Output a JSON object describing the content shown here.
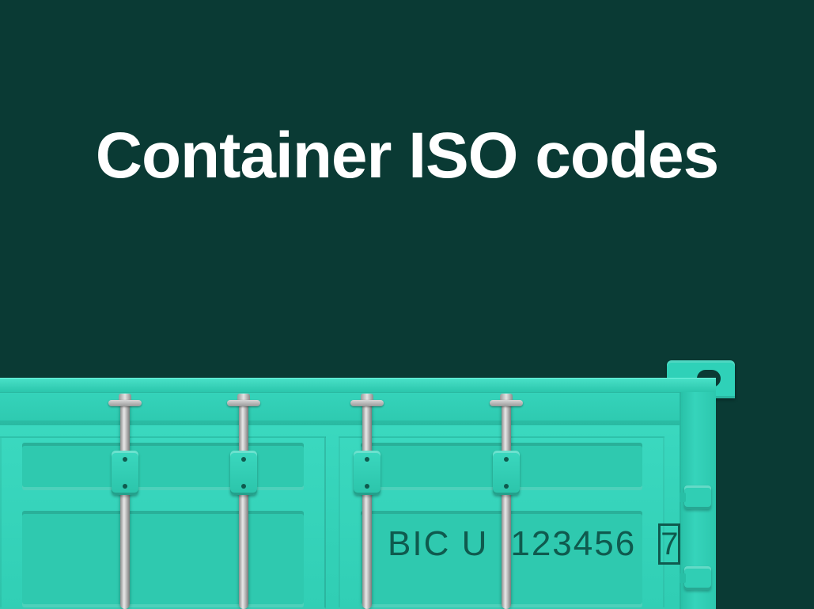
{
  "title": "Container ISO codes",
  "container": {
    "owner_code": "BIC U",
    "serial": "123456",
    "check_digit": "7"
  },
  "colors": {
    "background": "#0a3a34",
    "container": "#33d1b7",
    "text_on_container": "#0f5a4e",
    "title_text": "#ffffff"
  }
}
